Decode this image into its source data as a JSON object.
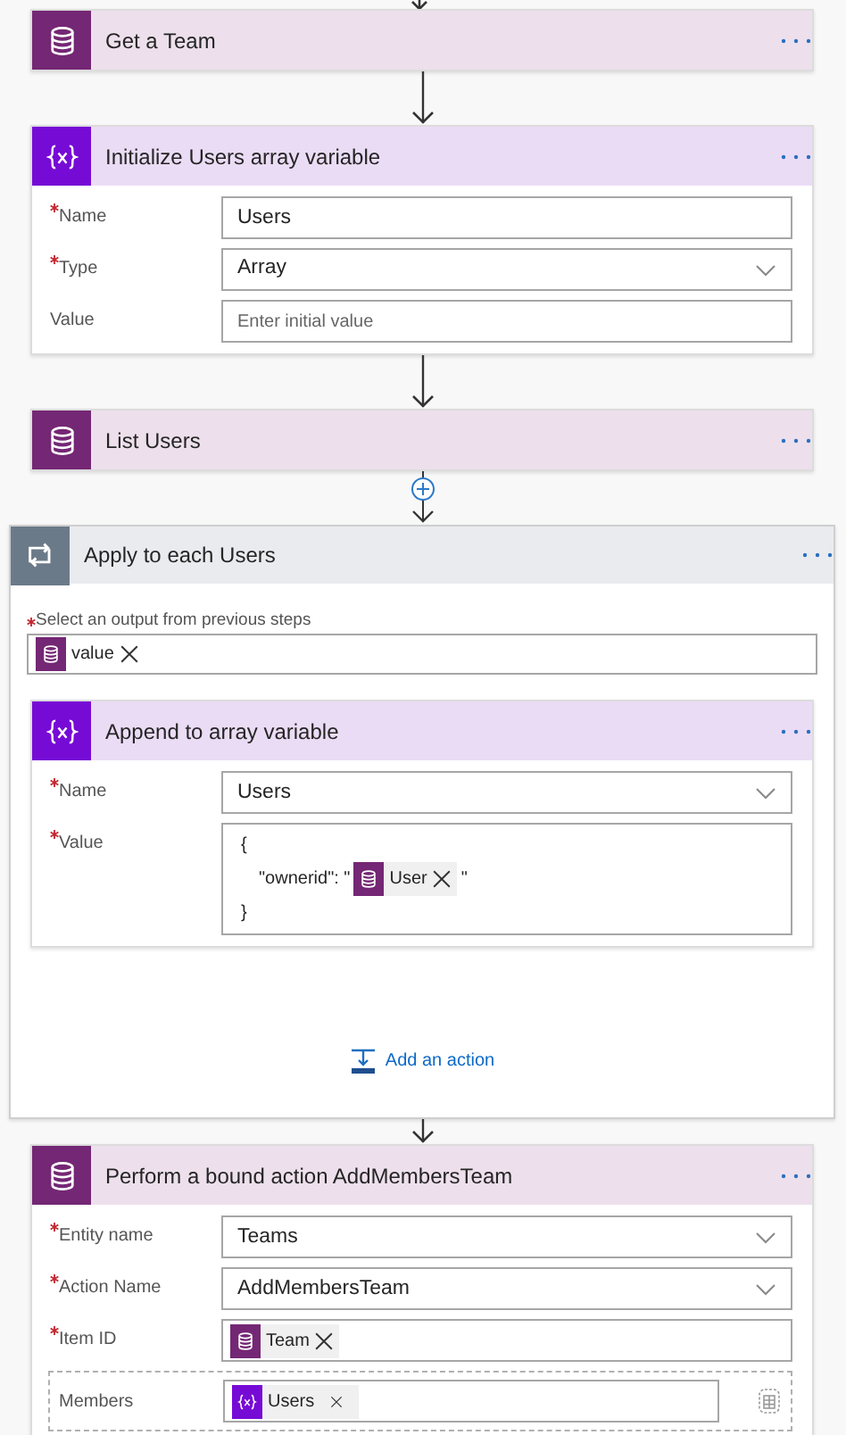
{
  "flow": {
    "steps": [
      {
        "kind": "dataverse",
        "title": "Get a Team"
      },
      {
        "kind": "variable",
        "title": "Initialize Users array variable",
        "fields": [
          {
            "kind": "text",
            "label": "Name",
            "required": true,
            "value": "Users"
          },
          {
            "kind": "dropdown",
            "label": "Type",
            "required": true,
            "value": "Array"
          },
          {
            "kind": "text",
            "label": "Value",
            "required": false,
            "placeholder": "Enter initial value"
          }
        ]
      },
      {
        "kind": "dataverse",
        "title": "List Users"
      },
      {
        "kind": "loop",
        "title": "Apply to each Users",
        "select_label": "Select an output from previous steps",
        "select_required": true,
        "select_tokens": [
          {
            "kind": "dataverse",
            "label": "value"
          }
        ],
        "children": [
          {
            "kind": "variable",
            "title": "Append to array variable",
            "fields": [
              {
                "kind": "dropdown",
                "label": "Name",
                "required": true,
                "value": "Users"
              },
              {
                "kind": "code",
                "label": "Value",
                "required": true,
                "lines": [
                  [
                    {
                      "kind": "text",
                      "text": "{"
                    }
                  ],
                  [
                    {
                      "kind": "text",
                      "text": "\"ownerid\": \""
                    },
                    {
                      "kind": "dataverse",
                      "label": "User"
                    },
                    {
                      "kind": "text",
                      "text": "\""
                    }
                  ],
                  [
                    {
                      "kind": "text",
                      "text": "}"
                    }
                  ]
                ]
              }
            ]
          }
        ],
        "add_action": "Add an action"
      },
      {
        "kind": "dataverse",
        "title": "Perform a bound action AddMembersTeam",
        "fields": [
          {
            "kind": "dropdown",
            "label": "Entity name",
            "required": true,
            "value": "Teams"
          },
          {
            "kind": "dropdown",
            "label": "Action Name",
            "required": true,
            "value": "AddMembersTeam"
          },
          {
            "kind": "tokens",
            "label": "Item ID",
            "required": true,
            "tokens": [
              {
                "kind": "dataverse",
                "label": "Team"
              }
            ]
          },
          {
            "kind": "array",
            "label": "Members",
            "required": false,
            "tokens": [
              {
                "kind": "variable",
                "label": "Users"
              }
            ]
          }
        ]
      }
    ]
  }
}
